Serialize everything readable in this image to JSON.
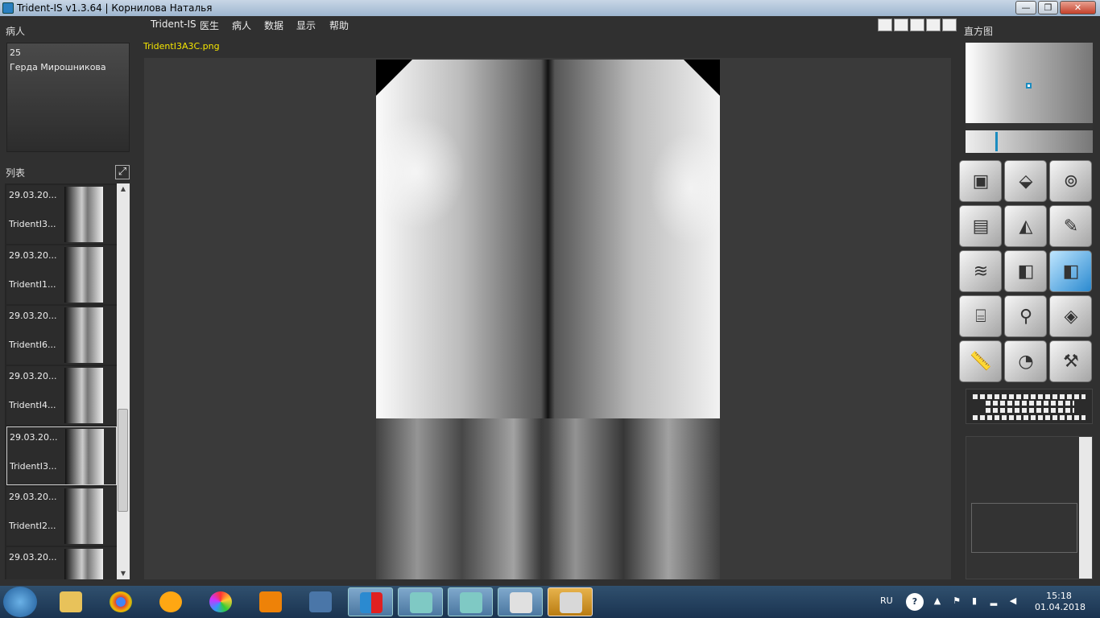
{
  "window": {
    "title": "Trident-IS v1.3.64 |  Корнилова Наталья",
    "minimize": "—",
    "maximize": "❐",
    "close": "✕"
  },
  "patient_panel": {
    "label": "病人",
    "id": "25",
    "name": "Герда Мирошникова"
  },
  "list_panel": {
    "label": "列表",
    "items": [
      {
        "date": "29.03.20...",
        "name": "TridentI3..."
      },
      {
        "date": "29.03.20...",
        "name": "TridentI1..."
      },
      {
        "date": "29.03.20...",
        "name": "TridentI6..."
      },
      {
        "date": "29.03.20...",
        "name": "TridentI4..."
      },
      {
        "date": "29.03.20...",
        "name": "TridentI3..."
      },
      {
        "date": "29.03.20...",
        "name": "TridentI2..."
      },
      {
        "date": "29.03.20...",
        "name": ""
      }
    ],
    "selected_index": 4
  },
  "menu": [
    "Trident-IS",
    "医生",
    "病人",
    "数据",
    "显示",
    "帮助"
  ],
  "viewer": {
    "filename": "TridentI3A3C.png"
  },
  "histogram": {
    "label": "直方图"
  },
  "tools": [
    "crop-icon",
    "eraser-icon",
    "knob-icon",
    "film-icon",
    "fan-icon",
    "pen-icon",
    "texture-icon",
    "cube-icon",
    "cube-blue-icon",
    "cylinder-icon",
    "flashlight-icon",
    "3d-surface-icon",
    "ruler-icon",
    "protractor-icon",
    "implant-icon"
  ],
  "taskbar": {
    "lang": "RU",
    "time": "15:18",
    "date": "01.04.2018"
  }
}
